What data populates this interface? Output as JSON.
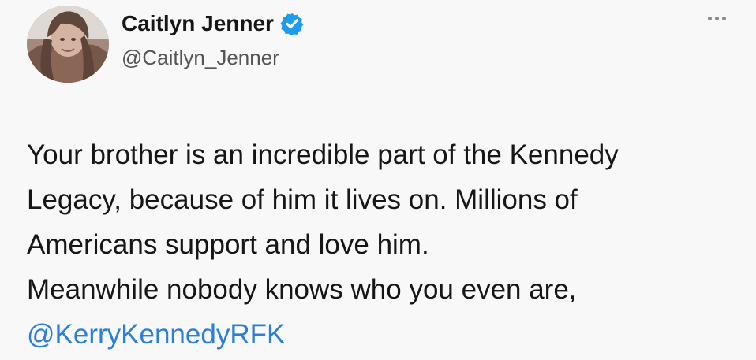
{
  "author": {
    "display_name": "Caitlyn Jenner",
    "handle": "@Caitlyn_Jenner"
  },
  "post": {
    "lines": [
      "Your brother is an incredible part of the Kennedy",
      "Legacy, because of him it lives on. Millions of",
      "Americans support and love him.",
      "Meanwhile nobody knows who you even are,"
    ],
    "mention": "@KerryKennedyRFK"
  },
  "icons": {
    "verified": "verified-badge-icon",
    "more": "more-options-icon"
  },
  "colors": {
    "verified": "#1d9bf0",
    "mention": "#2c7fd8",
    "text": "#161616",
    "secondary": "#555555"
  }
}
